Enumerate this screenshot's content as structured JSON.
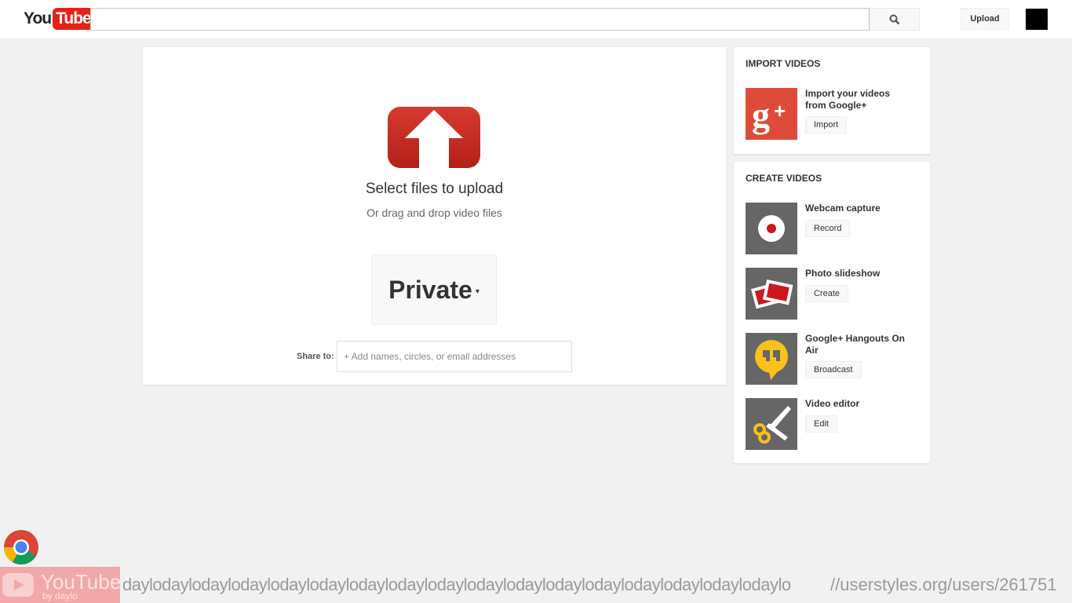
{
  "header": {
    "logo_you": "You",
    "logo_tube": "Tube",
    "search_placeholder": "",
    "upload_label": "Upload"
  },
  "upload": {
    "title": "Select files to upload",
    "subtitle": "Or drag and drop video files",
    "privacy_label": "Private",
    "share_label": "Share to:",
    "share_placeholder": "+ Add names, circles, or email addresses"
  },
  "import": {
    "title": "IMPORT VIDEOS",
    "item_title": "Import your videos from Google+",
    "item_button": "Import"
  },
  "create": {
    "title": "CREATE VIDEOS",
    "items": [
      {
        "title": "Webcam capture",
        "button": "Record"
      },
      {
        "title": "Photo slideshow",
        "button": "Create"
      },
      {
        "title": "Google+ Hangouts On Air",
        "button": "Broadcast"
      },
      {
        "title": "Video editor",
        "button": "Edit"
      }
    ]
  },
  "footer": {
    "badge_brand": "YouTube",
    "badge_by": "by daylo",
    "marquee": "daylodaylodaylodaylodaylodaylodaylodaylodaylodaylodaylodaylodaylodaylodaylodaylodaylo",
    "userstyles": "//userstyles.org/users/261751"
  },
  "colors": {
    "brand_red": "#e62117",
    "background": "#f1f1f1"
  }
}
